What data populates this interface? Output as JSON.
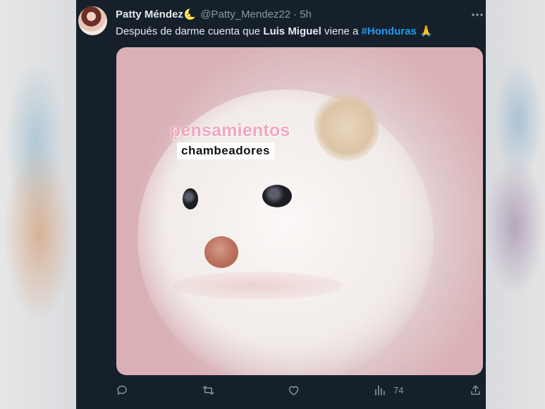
{
  "tweet": {
    "author_name": "Patty Méndez",
    "name_emoji": "🌜",
    "handle": "@Patty_Mendez22",
    "separator": "·",
    "time": "5h",
    "more_icon": "more-horizontal-icon",
    "text_before": "Después de darme cuenta que ",
    "text_bold": "Luis Miguel",
    "text_middle": " viene a ",
    "hashtag": "#Honduras",
    "text_emoji": "🙏"
  },
  "media": {
    "caption_top": "pensamientos",
    "caption_bottom": "chambeadores"
  },
  "actions": {
    "reply_icon": "reply-icon",
    "retweet_icon": "retweet-icon",
    "like_icon": "heart-icon",
    "views_icon": "views-chart-icon",
    "views_count": "74",
    "share_icon": "share-icon"
  },
  "colors": {
    "background": "#15202b",
    "text": "#e7e9ea",
    "secondary": "#8b98a5",
    "accent": "#1d9bf0"
  }
}
